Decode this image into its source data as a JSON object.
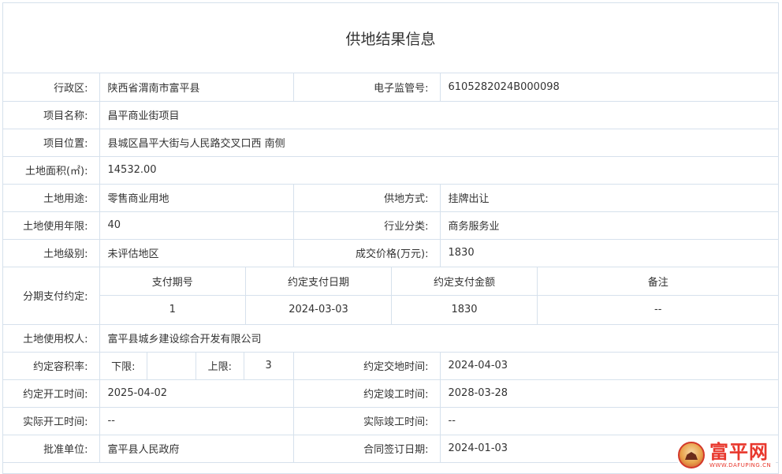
{
  "page": {
    "title": "供地结果信息"
  },
  "labels": {
    "district": "行政区:",
    "monitor_no": "电子监管号:",
    "project_name": "项目名称:",
    "project_location": "项目位置:",
    "land_area": "土地面积(㎡):",
    "land_use": "土地用途:",
    "supply_method": "供地方式:",
    "land_years": "土地使用年限:",
    "industry": "行业分类:",
    "land_level": "土地级别:",
    "deal_price": "成交价格(万元):",
    "installments": "分期支付约定:",
    "land_owner": "土地使用权人:",
    "far": "约定容积率:",
    "far_lower": "下限:",
    "far_upper": "上限:",
    "handover_time": "约定交地时间:",
    "start_time": "约定开工时间:",
    "completion_time": "约定竣工时间:",
    "actual_start": "实际开工时间:",
    "actual_completion": "实际竣工时间:",
    "approver": "批准单位:",
    "contract_date": "合同签订日期:"
  },
  "values": {
    "district": "陕西省渭南市富平县",
    "monitor_no": "6105282024B000098",
    "project_name": "昌平商业街项目",
    "project_location": "县城区昌平大街与人民路交叉口西 南侧",
    "land_area": "14532.00",
    "land_use": "零售商业用地",
    "supply_method": "挂牌出让",
    "land_years": "40",
    "industry": "商务服务业",
    "land_level": "未评估地区",
    "deal_price": "1830",
    "land_owner": "富平县城乡建设综合开发有限公司",
    "far_lower": "",
    "far_upper": "3",
    "handover_time": "2024-04-03",
    "start_time": "2025-04-02",
    "completion_time": "2028-03-28",
    "actual_start": "--",
    "actual_completion": "--",
    "approver": "富平县人民政府",
    "contract_date": "2024-01-03"
  },
  "installment_table": {
    "headers": [
      "支付期号",
      "约定支付日期",
      "约定支付金额",
      "备注"
    ],
    "rows": [
      [
        "1",
        "2024-03-03",
        "1830",
        "--"
      ]
    ]
  },
  "watermark": {
    "name": "富平网",
    "url": "WWW.DAFUPING.CN",
    "icon": "palace-gate-icon"
  },
  "colors": {
    "border": "#d6e1ec",
    "watermark_red": "#e8372c"
  }
}
